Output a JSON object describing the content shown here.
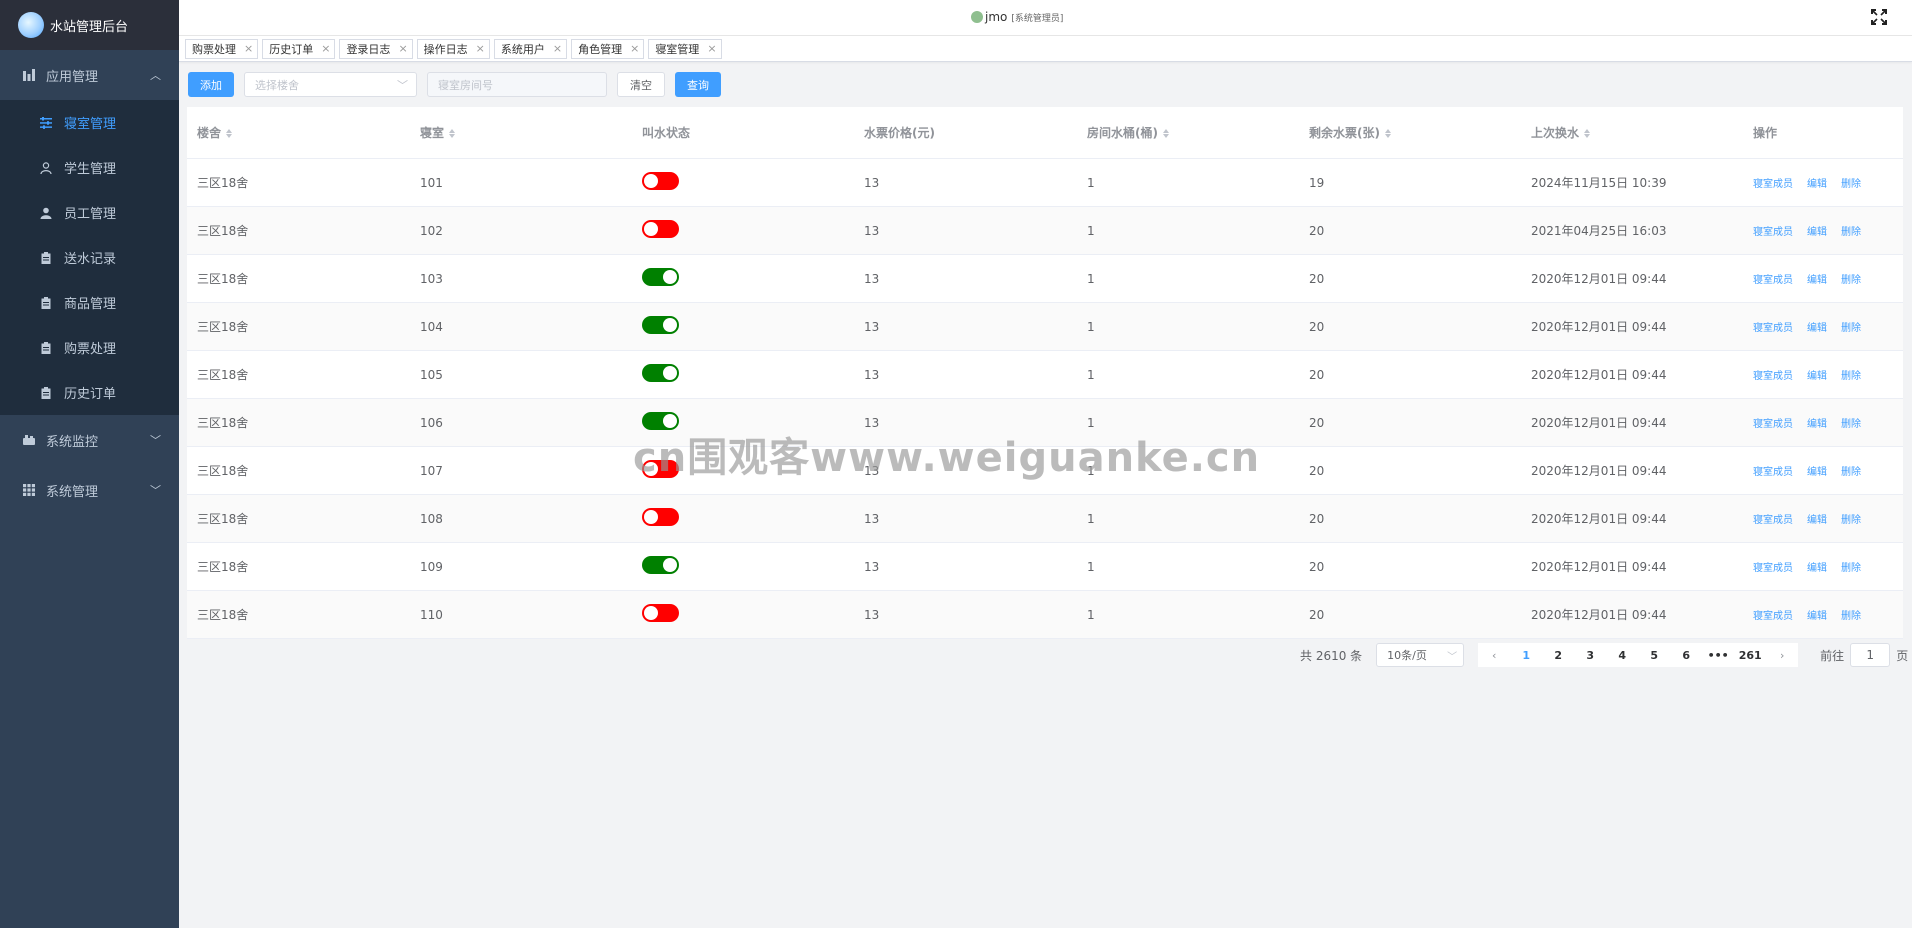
{
  "brand": {
    "title": "水站管理后台"
  },
  "sidebar": {
    "groups": [
      {
        "label": "应用管理",
        "icon": "chart-icon",
        "expanded": true
      },
      {
        "label": "系统监控",
        "icon": "monitor-icon",
        "expanded": false
      },
      {
        "label": "系统管理",
        "icon": "grid-icon",
        "expanded": false
      }
    ],
    "items": [
      {
        "label": "寝室管理",
        "icon": "sliders-icon",
        "active": true
      },
      {
        "label": "学生管理",
        "icon": "user-icon"
      },
      {
        "label": "员工管理",
        "icon": "user-filled-icon"
      },
      {
        "label": "送水记录",
        "icon": "clipboard-icon"
      },
      {
        "label": "商品管理",
        "icon": "clipboard-icon"
      },
      {
        "label": "购票处理",
        "icon": "clipboard-icon"
      },
      {
        "label": "历史订单",
        "icon": "clipboard-icon"
      }
    ]
  },
  "header": {
    "username": "jmo",
    "role": "[系统管理员]"
  },
  "tags": [
    "购票处理",
    "历史订单",
    "登录日志",
    "操作日志",
    "系统用户",
    "角色管理",
    "寝室管理"
  ],
  "toolbar": {
    "add_label": "添加",
    "building_placeholder": "选择楼舍",
    "room_placeholder": "寝室房间号",
    "clear_label": "清空",
    "query_label": "查询"
  },
  "table": {
    "columns": [
      "楼舍",
      "寝室",
      "叫水状态",
      "水票价格(元)",
      "房间水桶(桶)",
      "剩余水票(张)",
      "上次换水",
      "操作"
    ],
    "actions": [
      "寝室成员",
      "编辑",
      "删除"
    ],
    "rows": [
      {
        "building": "三区18舍",
        "room": "101",
        "status": false,
        "price": "13",
        "buckets": "1",
        "tickets": "19",
        "last": "2024年11月15日 10:39"
      },
      {
        "building": "三区18舍",
        "room": "102",
        "status": false,
        "price": "13",
        "buckets": "1",
        "tickets": "20",
        "last": "2021年04月25日 16:03"
      },
      {
        "building": "三区18舍",
        "room": "103",
        "status": true,
        "price": "13",
        "buckets": "1",
        "tickets": "20",
        "last": "2020年12月01日 09:44"
      },
      {
        "building": "三区18舍",
        "room": "104",
        "status": true,
        "price": "13",
        "buckets": "1",
        "tickets": "20",
        "last": "2020年12月01日 09:44"
      },
      {
        "building": "三区18舍",
        "room": "105",
        "status": true,
        "price": "13",
        "buckets": "1",
        "tickets": "20",
        "last": "2020年12月01日 09:44"
      },
      {
        "building": "三区18舍",
        "room": "106",
        "status": true,
        "price": "13",
        "buckets": "1",
        "tickets": "20",
        "last": "2020年12月01日 09:44"
      },
      {
        "building": "三区18舍",
        "room": "107",
        "status": false,
        "price": "13",
        "buckets": "1",
        "tickets": "20",
        "last": "2020年12月01日 09:44"
      },
      {
        "building": "三区18舍",
        "room": "108",
        "status": false,
        "price": "13",
        "buckets": "1",
        "tickets": "20",
        "last": "2020年12月01日 09:44"
      },
      {
        "building": "三区18舍",
        "room": "109",
        "status": true,
        "price": "13",
        "buckets": "1",
        "tickets": "20",
        "last": "2020年12月01日 09:44"
      },
      {
        "building": "三区18舍",
        "room": "110",
        "status": false,
        "price": "13",
        "buckets": "1",
        "tickets": "20",
        "last": "2020年12月01日 09:44"
      }
    ]
  },
  "pagination": {
    "total": "共 2610 条",
    "page_size": "10条/页",
    "pages": [
      "1",
      "2",
      "3",
      "4",
      "5",
      "6",
      "•••",
      "261"
    ],
    "current": "1",
    "goto_prefix": "前往",
    "goto_value": "1",
    "goto_suffix": "页"
  },
  "watermark": "cn围观客www.weiguanke.cn",
  "colors": {
    "accent": "#409eff",
    "sidebar": "#304156",
    "switch_on": "#008000",
    "switch_off": "#ff0000"
  }
}
